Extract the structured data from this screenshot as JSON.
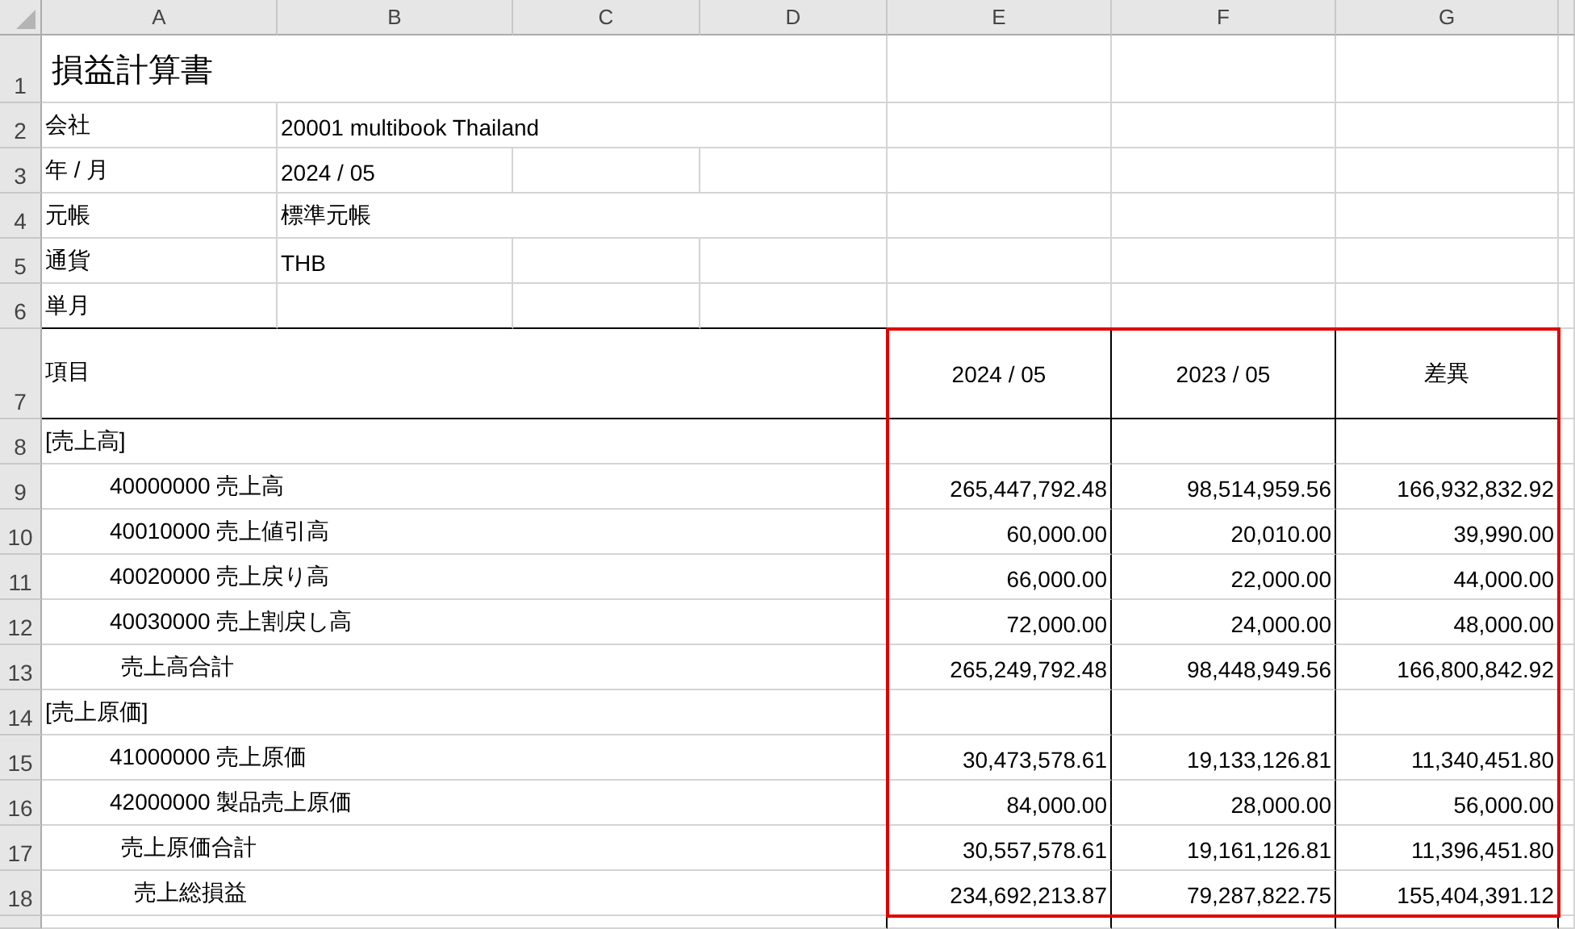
{
  "columns": [
    "A",
    "B",
    "C",
    "D",
    "E",
    "F",
    "G"
  ],
  "title_row": {
    "row": "1",
    "title": "損益計算書"
  },
  "info_rows": [
    {
      "row": "2",
      "label": "会社",
      "value": "20001 multibook Thailand",
      "merged": true
    },
    {
      "row": "3",
      "label": "年 / 月",
      "value": "2024 / 05",
      "merged": false
    },
    {
      "row": "4",
      "label": "元帳",
      "value": "標準元帳",
      "merged": true
    },
    {
      "row": "5",
      "label": "通貨",
      "value": "THB",
      "merged": false
    },
    {
      "row": "6",
      "label": "単月",
      "merged": false
    }
  ],
  "header": {
    "row": "7",
    "label": "項目",
    "columns": [
      "2024 / 05",
      "2023 / 05",
      "差異"
    ]
  },
  "rows": [
    {
      "row": "8",
      "kind": "section",
      "label": "[売上高]"
    },
    {
      "row": "9",
      "kind": "account",
      "label": "40000000 売上高",
      "values": [
        "265,447,792.48",
        "98,514,959.56",
        "166,932,832.92"
      ]
    },
    {
      "row": "10",
      "kind": "account",
      "label": "40010000 売上値引高",
      "values": [
        "60,000.00",
        "20,010.00",
        "39,990.00"
      ]
    },
    {
      "row": "11",
      "kind": "account",
      "label": "40020000 売上戻り高",
      "values": [
        "66,000.00",
        "22,000.00",
        "44,000.00"
      ]
    },
    {
      "row": "12",
      "kind": "account",
      "label": "40030000 売上割戻し高",
      "values": [
        "72,000.00",
        "24,000.00",
        "48,000.00"
      ]
    },
    {
      "row": "13",
      "kind": "subtotal",
      "label": "売上高合計",
      "values": [
        "265,249,792.48",
        "98,448,949.56",
        "166,800,842.92"
      ]
    },
    {
      "row": "14",
      "kind": "section",
      "label": "[売上原価]"
    },
    {
      "row": "15",
      "kind": "account",
      "label": "41000000 売上原価",
      "values": [
        "30,473,578.61",
        "19,133,126.81",
        "11,340,451.80"
      ]
    },
    {
      "row": "16",
      "kind": "account",
      "label": "42000000 製品売上原価",
      "values": [
        "84,000.00",
        "28,000.00",
        "56,000.00"
      ]
    },
    {
      "row": "17",
      "kind": "subtotal",
      "label": "売上原価合計",
      "values": [
        "30,557,578.61",
        "19,161,126.81",
        "11,396,451.80"
      ]
    },
    {
      "row": "18",
      "kind": "total",
      "label": "売上総損益",
      "values": [
        "234,692,213.87",
        "79,287,822.75",
        "155,404,391.12"
      ]
    }
  ]
}
